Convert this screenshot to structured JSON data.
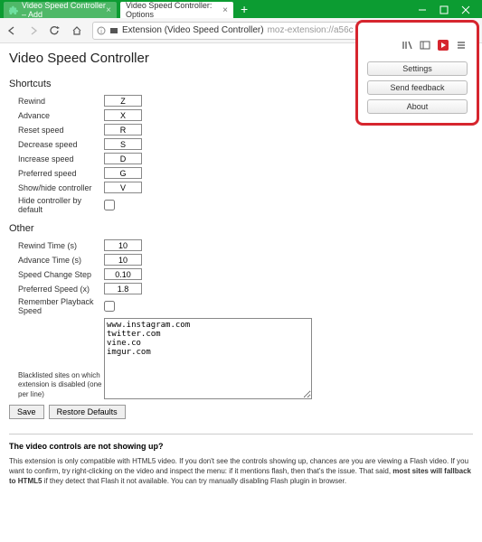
{
  "tabs": {
    "inactive": "Video Speed Controller – Add",
    "active": "Video Speed Controller: Options"
  },
  "url": {
    "label": "Extension (Video Speed Controller)",
    "rest": "moz-extension://a56c"
  },
  "popup": {
    "settings": "Settings",
    "feedback": "Send feedback",
    "about": "About"
  },
  "page_title": "Video Speed Controller",
  "sections": {
    "shortcuts": "Shortcuts",
    "other": "Other"
  },
  "shortcuts": {
    "rewind": {
      "label": "Rewind",
      "value": "Z"
    },
    "advance": {
      "label": "Advance",
      "value": "X"
    },
    "reset": {
      "label": "Reset speed",
      "value": "R"
    },
    "decrease": {
      "label": "Decrease speed",
      "value": "S"
    },
    "increase": {
      "label": "Increase speed",
      "value": "D"
    },
    "preferred": {
      "label": "Preferred speed",
      "value": "G"
    },
    "showhide": {
      "label": "Show/hide controller",
      "value": "V"
    },
    "hide_default": {
      "label": "Hide controller by default"
    }
  },
  "other": {
    "rewind_time": {
      "label": "Rewind Time (s)",
      "value": "10"
    },
    "advance_time": {
      "label": "Advance Time (s)",
      "value": "10"
    },
    "speed_step": {
      "label": "Speed Change Step",
      "value": "0.10"
    },
    "pref_speed": {
      "label": "Preferred Speed (x)",
      "value": "1.8"
    },
    "remember": {
      "label": "Remember Playback Speed"
    },
    "blacklist": {
      "label": "Blacklisted sites on which extension is disabled (one per line)",
      "value": "www.instagram.com\ntwitter.com\nvine.co\nimgur.com"
    }
  },
  "buttons": {
    "save": "Save",
    "restore": "Restore Defaults"
  },
  "help": {
    "title": "The video controls are not showing up?",
    "text_1": "This extension is only compatible with HTML5 video. If you don't see the controls showing up, chances are you are viewing a Flash video. If you want to confirm, try right-clicking on the video and inspect the menu: if it mentions flash, then that's the issue. That said, ",
    "text_bold": "most sites will fallback to HTML5",
    "text_2": " if they detect that Flash it not available. You can try manually disabling Flash plugin in browser."
  }
}
